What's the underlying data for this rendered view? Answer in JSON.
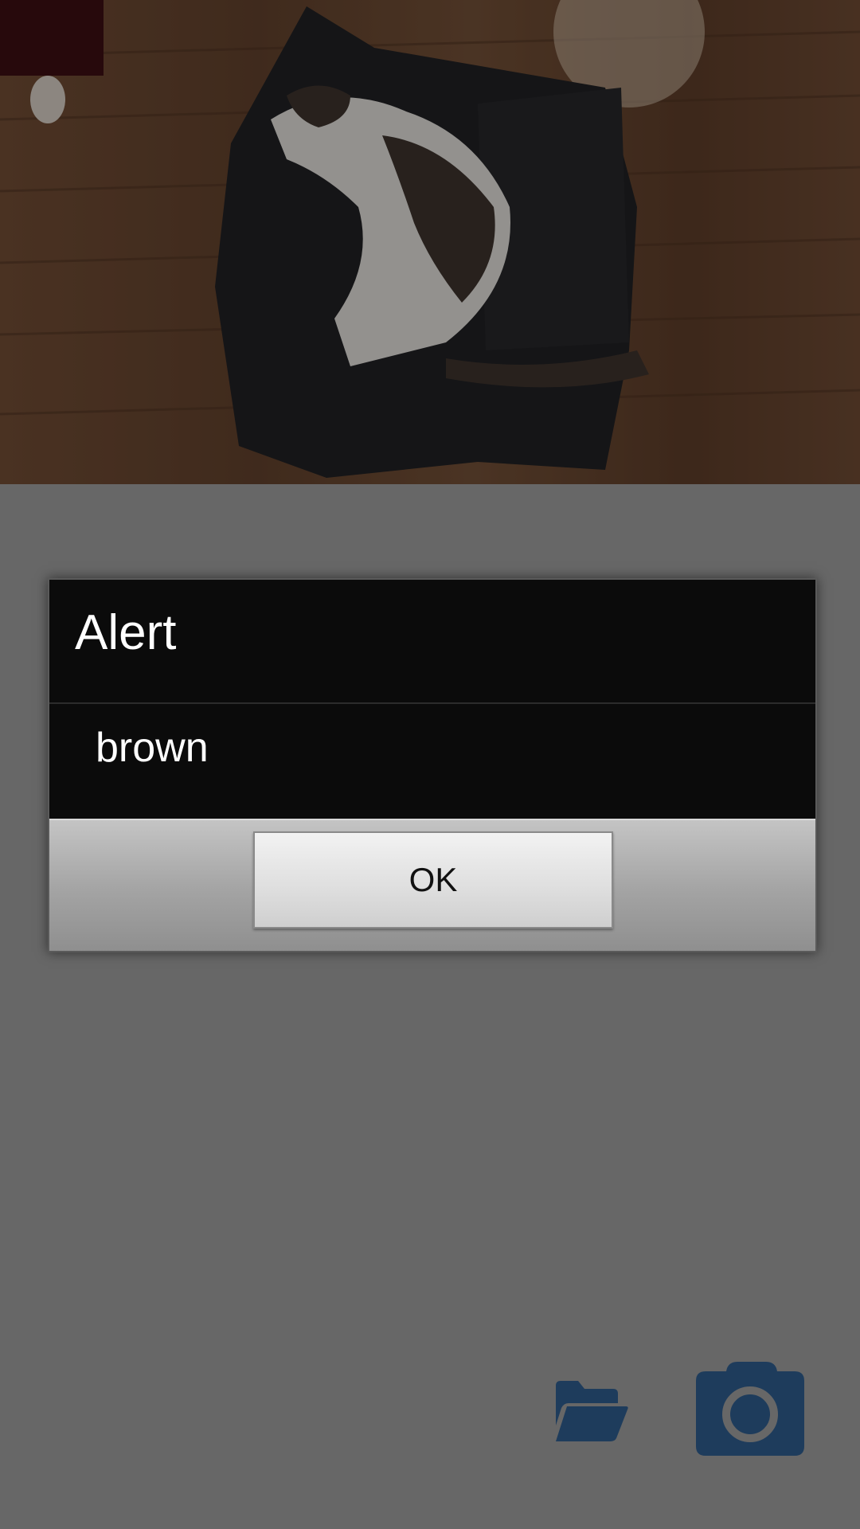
{
  "dialog": {
    "title": "Alert",
    "message": "brown",
    "ok_label": "OK"
  },
  "icons": {
    "folder": "open-folder-icon",
    "camera": "camera-icon"
  },
  "colors": {
    "scrim": "#676767",
    "dialog_body": "#0b0b0b",
    "icon_accent": "#1e3c5c"
  }
}
